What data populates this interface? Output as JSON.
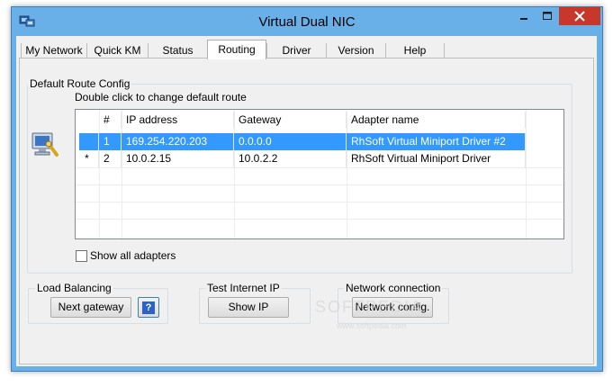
{
  "window": {
    "title": "Virtual Dual NIC"
  },
  "tabs": [
    {
      "label": "My Network"
    },
    {
      "label": "Quick KM"
    },
    {
      "label": "Status"
    },
    {
      "label": "Routing"
    },
    {
      "label": "Driver"
    },
    {
      "label": "Version"
    },
    {
      "label": "Help"
    }
  ],
  "active_tab": "Routing",
  "route_config": {
    "group_label": "Default Route Config",
    "hint": "Double click to change default route",
    "columns": [
      "#",
      "IP address",
      "Gateway",
      "Adapter name"
    ],
    "rows": [
      {
        "mark": "",
        "num": "1",
        "ip": "169.254.220.203",
        "gateway": "0.0.0.0",
        "adapter": "RhSoft Virtual Miniport Driver #2",
        "selected": true
      },
      {
        "mark": "*",
        "num": "2",
        "ip": "10.0.2.15",
        "gateway": "10.0.2.2",
        "adapter": "RhSoft Virtual Miniport Driver",
        "selected": false
      }
    ],
    "show_all_label": "Show all adapters"
  },
  "load_balancing": {
    "label": "Load Balancing",
    "next_gateway": "Next gateway",
    "help": "?"
  },
  "test_ip": {
    "label": "Test Internet IP",
    "show_ip": "Show IP"
  },
  "network_connection": {
    "label": "Network connection",
    "config": "Network config."
  },
  "watermark": {
    "brand": "SOFTPEDIA",
    "url": "www.softpedia.com"
  },
  "colors": {
    "titlebar": "#6ab0e8",
    "close": "#c7382a",
    "selection": "#3399ff"
  },
  "icons": [
    "app-icon",
    "minimize-icon",
    "maximize-icon",
    "close-icon",
    "network-computer-icon"
  ]
}
